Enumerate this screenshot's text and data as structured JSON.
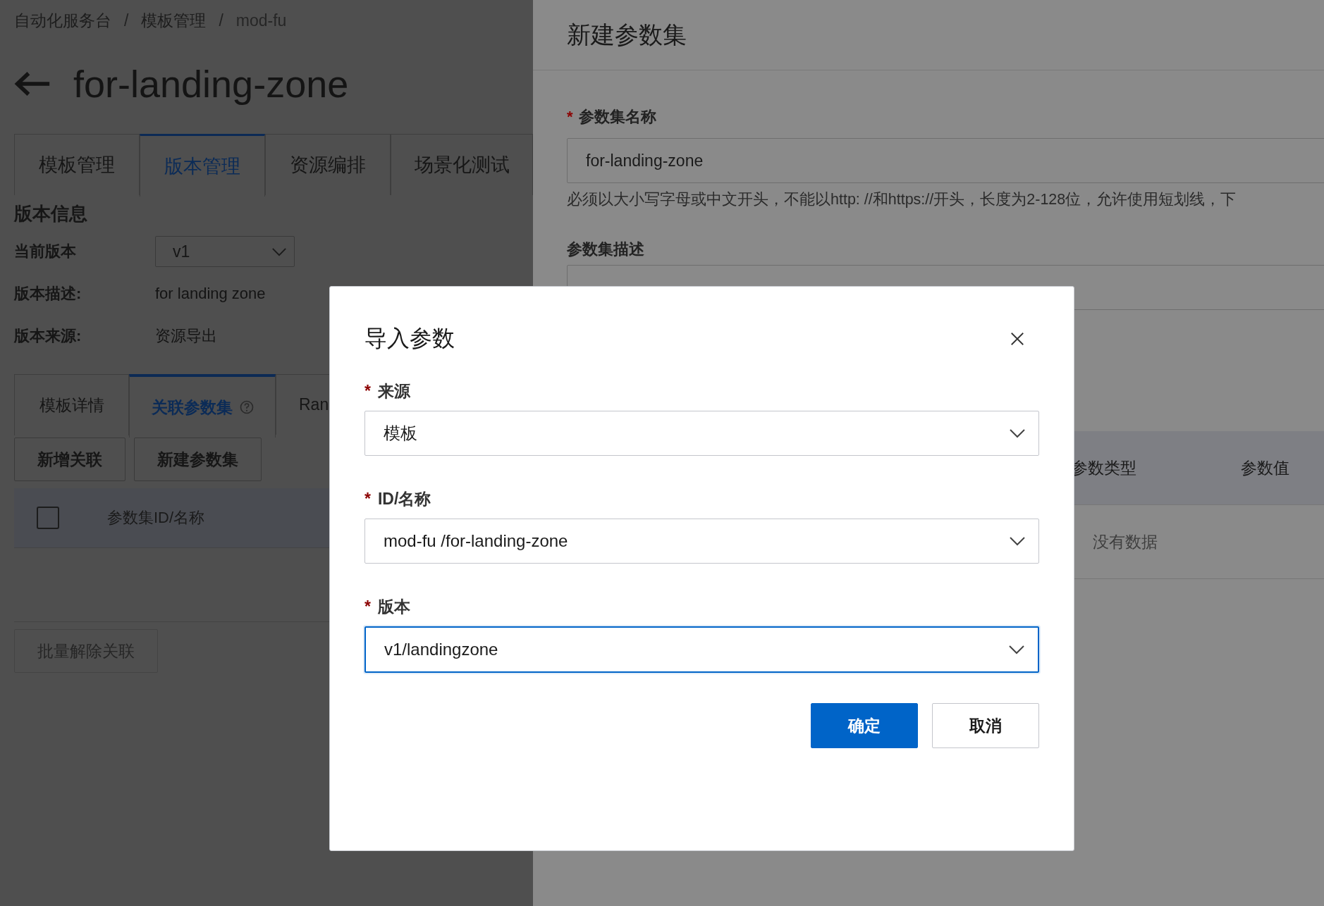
{
  "breadcrumb": {
    "separator": "/",
    "items": [
      {
        "label": "自动化服务台"
      },
      {
        "label": "模板管理"
      },
      {
        "label": "mod-fu"
      }
    ]
  },
  "page": {
    "title": "for-landing-zone"
  },
  "tabs": [
    {
      "label": "模板管理",
      "selected": false
    },
    {
      "label": "版本管理",
      "selected": true
    },
    {
      "label": "资源编排",
      "selected": false
    },
    {
      "label": "场景化测试",
      "selected": false
    }
  ],
  "version_info": {
    "heading": "版本信息",
    "current_version": {
      "label": "当前版本",
      "value": "v1"
    },
    "fields": [
      {
        "label": "版本描述:",
        "value": "for landing zone"
      },
      {
        "label": "版本来源:",
        "value": "资源导出"
      }
    ]
  },
  "sub_tabs": [
    {
      "label": "模板详情",
      "selected": false,
      "help": false
    },
    {
      "label": "关联参数集",
      "selected": true,
      "help": true
    },
    {
      "label": "Ran",
      "selected": false,
      "help": false
    }
  ],
  "actions": [
    {
      "label": "新增关联",
      "disabled": false
    },
    {
      "label": "新建参数集",
      "disabled": false
    }
  ],
  "table": {
    "select_all_checked": false,
    "columns": [
      "参数集ID/名称"
    ]
  },
  "bulk_action": {
    "label": "批量解除关联",
    "disabled": true
  },
  "drawer": {
    "title": "新建参数集",
    "required_mark": "*",
    "fields": [
      {
        "label": "参数集名称",
        "required": true,
        "value": "for-landing-zone",
        "help": "必须以大小写字母或中文开头，不能以http: //和https://开头，长度为2-128位，允许使用短划线，下"
      },
      {
        "label": "参数集描述",
        "required": false
      }
    ],
    "table": {
      "columns": [
        "参数类型",
        "参数值"
      ],
      "empty_text": "没有数据"
    }
  },
  "modal": {
    "title": "导入参数",
    "required_mark": "*",
    "fields": [
      {
        "label": "来源",
        "required": true,
        "value": "模板",
        "focused": false
      },
      {
        "label": "ID/名称",
        "required": true,
        "value": "mod-fu /for-landing-zone",
        "focused": false
      },
      {
        "label": "版本",
        "required": true,
        "value": "v1/landingzone",
        "focused": true
      }
    ],
    "buttons": [
      {
        "label": "确定",
        "kind": "primary"
      },
      {
        "label": "取消",
        "kind": "default"
      }
    ]
  }
}
